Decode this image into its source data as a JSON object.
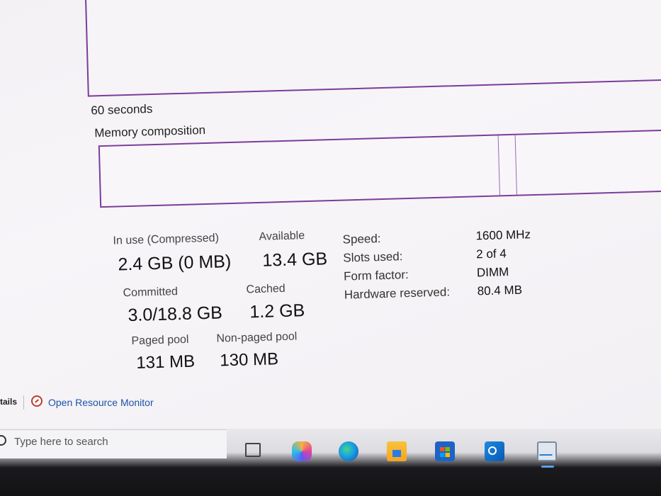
{
  "graph": {
    "time_label": "60 seconds"
  },
  "composition": {
    "title": "Memory composition"
  },
  "stats": {
    "in_use_label": "In use (Compressed)",
    "in_use_value": "2.4 GB (0 MB)",
    "available_label": "Available",
    "available_value": "13.4 GB",
    "committed_label": "Committed",
    "committed_value": "3.0/18.8 GB",
    "cached_label": "Cached",
    "cached_value": "1.2 GB",
    "paged_pool_label": "Paged pool",
    "paged_pool_value": "131 MB",
    "non_paged_pool_label": "Non-paged pool",
    "non_paged_pool_value": "130 MB"
  },
  "specs": {
    "speed_label": "Speed:",
    "speed_value": "1600 MHz",
    "slots_label": "Slots used:",
    "slots_value": "2 of 4",
    "form_label": "Form factor:",
    "form_value": "DIMM",
    "reserved_label": "Hardware reserved:",
    "reserved_value": "80.4 MB"
  },
  "footer": {
    "details_text": "tails",
    "open_monitor_label": "Open Resource Monitor"
  },
  "taskbar": {
    "search_placeholder": "Type here to search",
    "icons": [
      "task-view-icon",
      "copilot-icon",
      "edge-icon",
      "file-explorer-icon",
      "store-icon",
      "outlook-icon",
      "task-manager-icon"
    ]
  },
  "colors": {
    "accent_purple": "#7c3b9c",
    "link_blue": "#1d52a8"
  }
}
